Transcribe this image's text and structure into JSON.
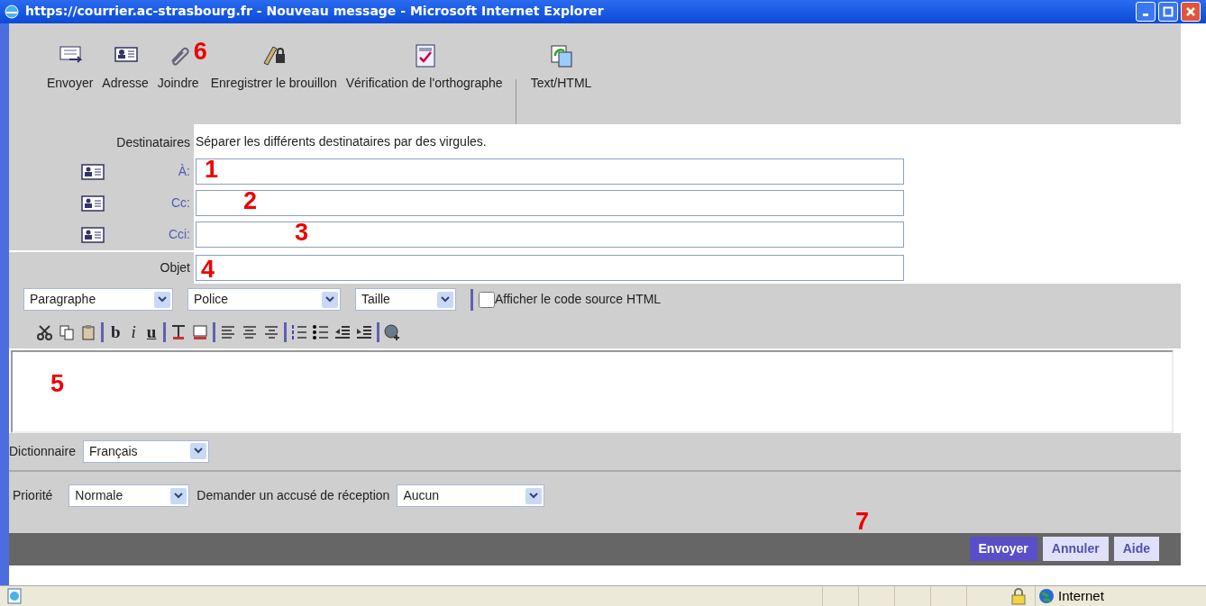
{
  "window": {
    "title": "https://courrier.ac-strasbourg.fr - Nouveau message - Microsoft Internet Explorer"
  },
  "toolbar": {
    "groups": [
      [
        {
          "label": "Envoyer"
        },
        {
          "label": "Adresse"
        },
        {
          "label": "Joindre",
          "annotation": "6"
        },
        {
          "label": "Enregistrer le brouillon"
        },
        {
          "label": "Vérification de l'orthographe"
        }
      ],
      [
        {
          "label": "Text/HTML"
        }
      ]
    ]
  },
  "recipients": {
    "heading": "Destinataires",
    "hint": "Séparer les différents destinataires par des virgules.",
    "fields": [
      {
        "label": "À:",
        "annotation": "1"
      },
      {
        "label": "Cc:",
        "annotation": "2"
      },
      {
        "label": "Cci:",
        "annotation": "3"
      }
    ]
  },
  "subject": {
    "label": "Objet",
    "annotation": "4"
  },
  "format_bar": {
    "selects": [
      "Paragraphe",
      "Police",
      "Taille"
    ],
    "source_checkbox": {
      "label": "Afficher le code source HTML",
      "checked": false
    }
  },
  "style_buttons": [
    "b",
    "i",
    "u"
  ],
  "editor": {
    "annotation": "5"
  },
  "dictionary": {
    "label": "Dictionnaire",
    "value": "Français"
  },
  "priority": {
    "label": "Priorité",
    "value": "Normale"
  },
  "receipt": {
    "label": "Demander un accusé de réception",
    "value": "Aucun"
  },
  "actions": {
    "annotation": "7",
    "buttons": [
      {
        "label": "Envoyer",
        "primary": true
      },
      {
        "label": "Annuler",
        "primary": false
      },
      {
        "label": "Aide",
        "primary": false
      }
    ]
  },
  "status_bar": {
    "zone": "Internet"
  }
}
